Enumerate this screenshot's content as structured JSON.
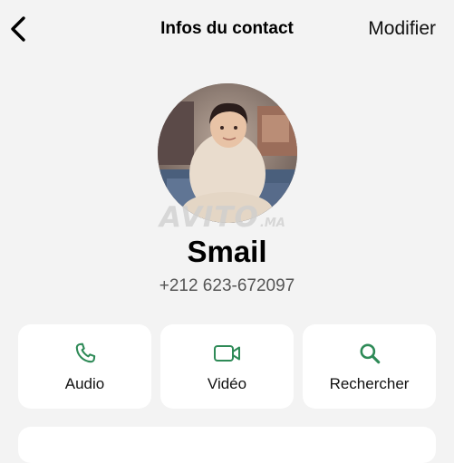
{
  "header": {
    "back_icon": "chevron-left-icon",
    "title": "Infos du contact",
    "edit_label": "Modifier"
  },
  "profile": {
    "name": "Smail",
    "phone": "+212 623-672097",
    "watermark_text": "AVITO",
    "watermark_suffix": ".MA"
  },
  "actions": [
    {
      "label": "Audio",
      "icon": "phone-icon"
    },
    {
      "label": "Vidéo",
      "icon": "video-camera-icon"
    },
    {
      "label": "Rechercher",
      "icon": "search-icon"
    }
  ],
  "colors": {
    "background": "#f3f3f3",
    "card": "#ffffff",
    "accent_green": "#2e8a57",
    "phone_text": "#555555"
  }
}
